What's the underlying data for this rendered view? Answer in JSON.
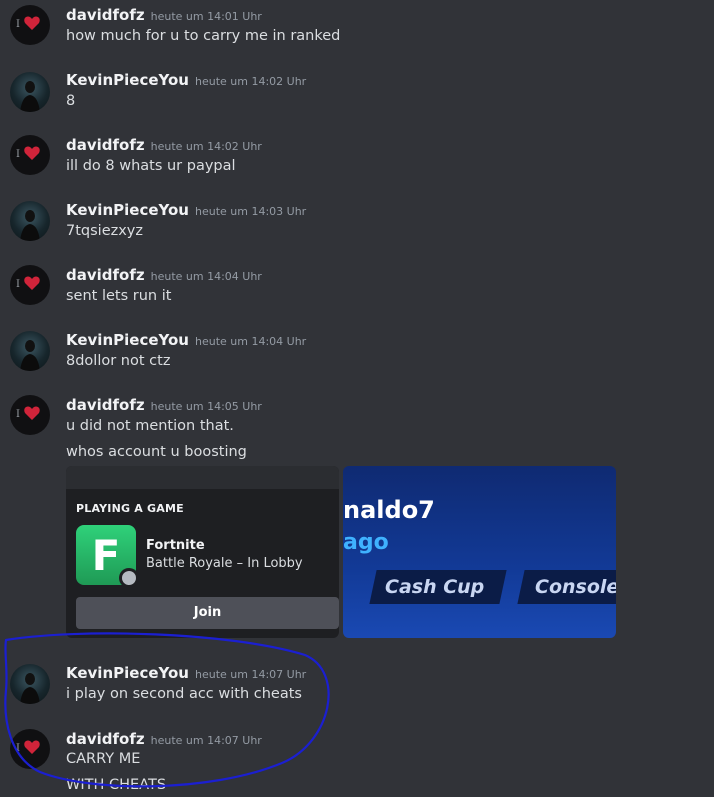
{
  "messages": [
    {
      "author": "davidfofz",
      "time": "heute um 14:01 Uhr",
      "lines": [
        "how much for u to carry me in ranked"
      ]
    },
    {
      "author": "KevinPieceYou",
      "time": "heute um 14:02 Uhr",
      "lines": [
        "8"
      ]
    },
    {
      "author": "davidfofz",
      "time": "heute um 14:02 Uhr",
      "lines": [
        "ill do 8 whats ur paypal"
      ]
    },
    {
      "author": "KevinPieceYou",
      "time": "heute um 14:03 Uhr",
      "lines": [
        "7tqsiezxyz"
      ]
    },
    {
      "author": "davidfofz",
      "time": "heute um 14:04 Uhr",
      "lines": [
        "sent lets run it"
      ]
    },
    {
      "author": "KevinPieceYou",
      "time": "heute um 14:04 Uhr",
      "lines": [
        "8dollor not ctz"
      ]
    },
    {
      "author": "davidfofz",
      "time": "heute um 14:05 Uhr",
      "lines": [
        "u did not mention that.",
        "whos account u boosting"
      ]
    },
    {
      "author": "KevinPieceYou",
      "time": "heute um 14:07 Uhr",
      "lines": [
        "i play on second acc with cheats"
      ]
    },
    {
      "author": "davidfofz",
      "time": "heute um 14:07 Uhr",
      "lines": [
        "CARRY ME",
        "WITH CHEATS"
      ]
    }
  ],
  "activity": {
    "label": "PLAYING A GAME",
    "game_title": "Fortnite",
    "game_state": "Battle Royale – In Lobby",
    "icon_letter": "F",
    "join_label": "Join"
  },
  "banner": {
    "name": "naldo7",
    "sub": "ago",
    "tags": [
      "Cash Cup",
      "Console"
    ]
  },
  "colors": {
    "background": "#313338",
    "annotation_circle": "#1b1fd1",
    "join_button": "#4e5058"
  },
  "icons": [
    "avatar-heart",
    "avatar-portrait",
    "platform-icon"
  ]
}
